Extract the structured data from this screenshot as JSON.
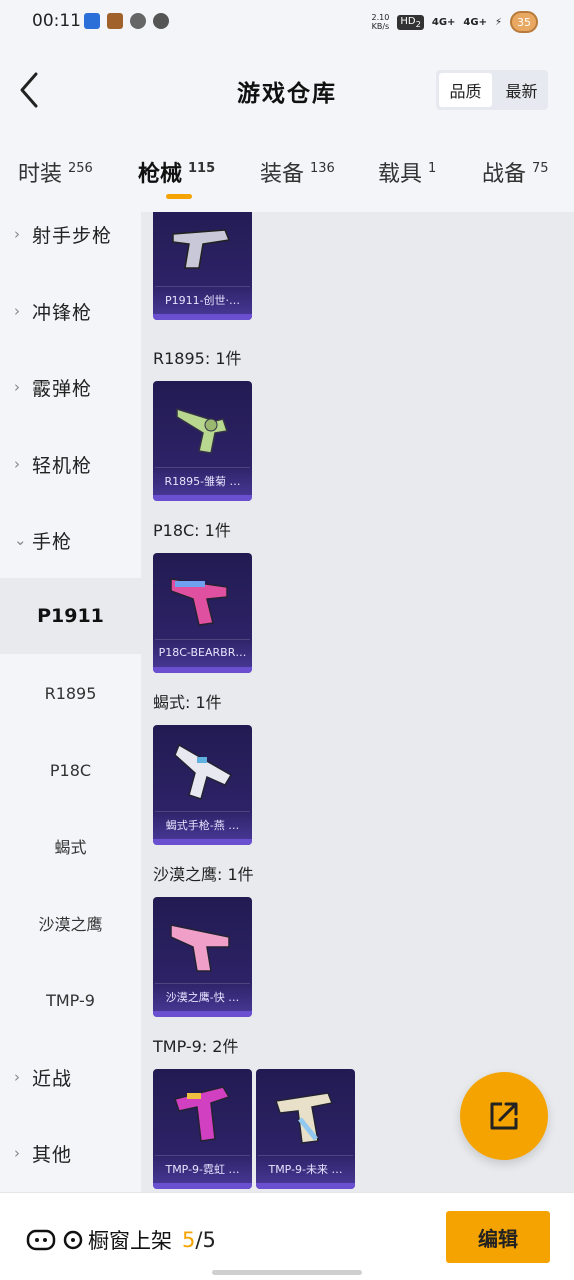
{
  "status_bar": {
    "time": "00:11",
    "net_speed": "2.10",
    "net_unit": "KB/s",
    "hd": "HD",
    "hd_sub": "2",
    "signal1": "4G+",
    "signal2": "4G+",
    "battery": "35"
  },
  "header": {
    "title": "游戏仓库",
    "sort_options": [
      "品质",
      "最新"
    ],
    "active_sort": "品质"
  },
  "tabs": [
    {
      "label": "时装",
      "count": "256"
    },
    {
      "label": "枪械",
      "count": "115"
    },
    {
      "label": "装备",
      "count": "136"
    },
    {
      "label": "载具",
      "count": "1"
    },
    {
      "label": "战备",
      "count": "75"
    }
  ],
  "active_tab": "枪械",
  "sidebar": {
    "categories": [
      {
        "label": "射手步枪",
        "expanded": false
      },
      {
        "label": "冲锋枪",
        "expanded": false
      },
      {
        "label": "霰弹枪",
        "expanded": false
      },
      {
        "label": "轻机枪",
        "expanded": false
      },
      {
        "label": "手枪",
        "expanded": true
      },
      {
        "label": "近战",
        "expanded": false
      },
      {
        "label": "其他",
        "expanded": false
      }
    ],
    "subitems": [
      "P1911",
      "R1895",
      "P18C",
      "蝎式",
      "沙漠之鹰",
      "TMP-9"
    ],
    "active_subitem": "P1911"
  },
  "content": {
    "groups": [
      {
        "label": "",
        "items": [
          {
            "name": "P1911-创世·…",
            "color": "#c8c8d8"
          }
        ]
      },
      {
        "label": "R1895: 1件",
        "items": [
          {
            "name": "R1895-雏菊 …",
            "color": "#b8d890"
          }
        ]
      },
      {
        "label": "P18C: 1件",
        "items": [
          {
            "name": "P18C-BEARBR…",
            "color": "#e050a0"
          }
        ]
      },
      {
        "label": "蝎式: 1件",
        "items": [
          {
            "name": "蝎式手枪-燕 …",
            "color": "#e8e8f0"
          }
        ]
      },
      {
        "label": "沙漠之鹰: 1件",
        "items": [
          {
            "name": "沙漠之鹰-快 …",
            "color": "#f0a0c8"
          }
        ]
      },
      {
        "label": "TMP-9: 2件",
        "items": [
          {
            "name": "TMP-9-霓虹 …",
            "color": "#d040c0"
          },
          {
            "name": "TMP-9-未来 …",
            "color": "#e8e0c8"
          }
        ]
      }
    ]
  },
  "bottom_bar": {
    "shelf_label": "橱窗上架",
    "shelf_used": "5",
    "shelf_total": "/5",
    "edit_label": "编辑"
  },
  "colors": {
    "accent": "#f5a300",
    "card_bg": "#2d2266"
  }
}
